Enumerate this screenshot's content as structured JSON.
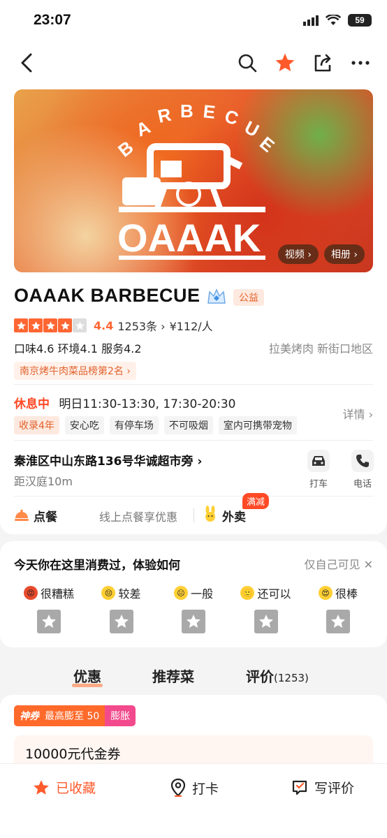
{
  "status": {
    "time": "23:07",
    "battery": "59"
  },
  "hero": {
    "video_label": "视频",
    "album_label": "相册"
  },
  "shop": {
    "name": "OAAAK BARBECUE",
    "charity_badge": "公益",
    "rating_score": "4.4",
    "review_count": "1253条",
    "price": "¥112/人",
    "sub_scores": "口味4.6 环境4.1 服务4.2",
    "categories": "拉美烤肉 新街口地区",
    "rank": "南京烤牛肉菜品榜第2名",
    "stars_filled": 4
  },
  "hours": {
    "status": "休息中",
    "text": "明日11:30-13:30, 17:30-20:30",
    "detail_label": "详情"
  },
  "tags": [
    "收录4年",
    "安心吃",
    "有停车场",
    "不可吸烟",
    "室内可携带宠物"
  ],
  "location": {
    "address": "秦淮区中山东路136号华诚超市旁",
    "distance": "距汉庭10m",
    "taxi_label": "打车",
    "phone_label": "电话"
  },
  "order": {
    "label": "点餐",
    "desc": "线上点餐享优惠",
    "delivery_label": "外卖",
    "delivery_badge": "满减"
  },
  "feedback": {
    "question": "今天你在这里消费过，体验如何",
    "private": "仅自己可见",
    "options": [
      "很糟糕",
      "较差",
      "一般",
      "还可以",
      "很棒"
    ]
  },
  "tabs": {
    "deals": "优惠",
    "dishes": "推荐菜",
    "reviews": "评价",
    "reviews_count": "(1253)"
  },
  "deals": {
    "god_label": "神券",
    "max_label": "最高膨至 50",
    "expand_label": "膨胀",
    "voucher_title": "10000元代金券"
  },
  "bottom": {
    "fav": "已收藏",
    "checkin": "打卡",
    "review": "写评价"
  },
  "colors": {
    "accent": "#ff5a2b",
    "star": "#ff6633",
    "pink": "#f24a8c"
  }
}
